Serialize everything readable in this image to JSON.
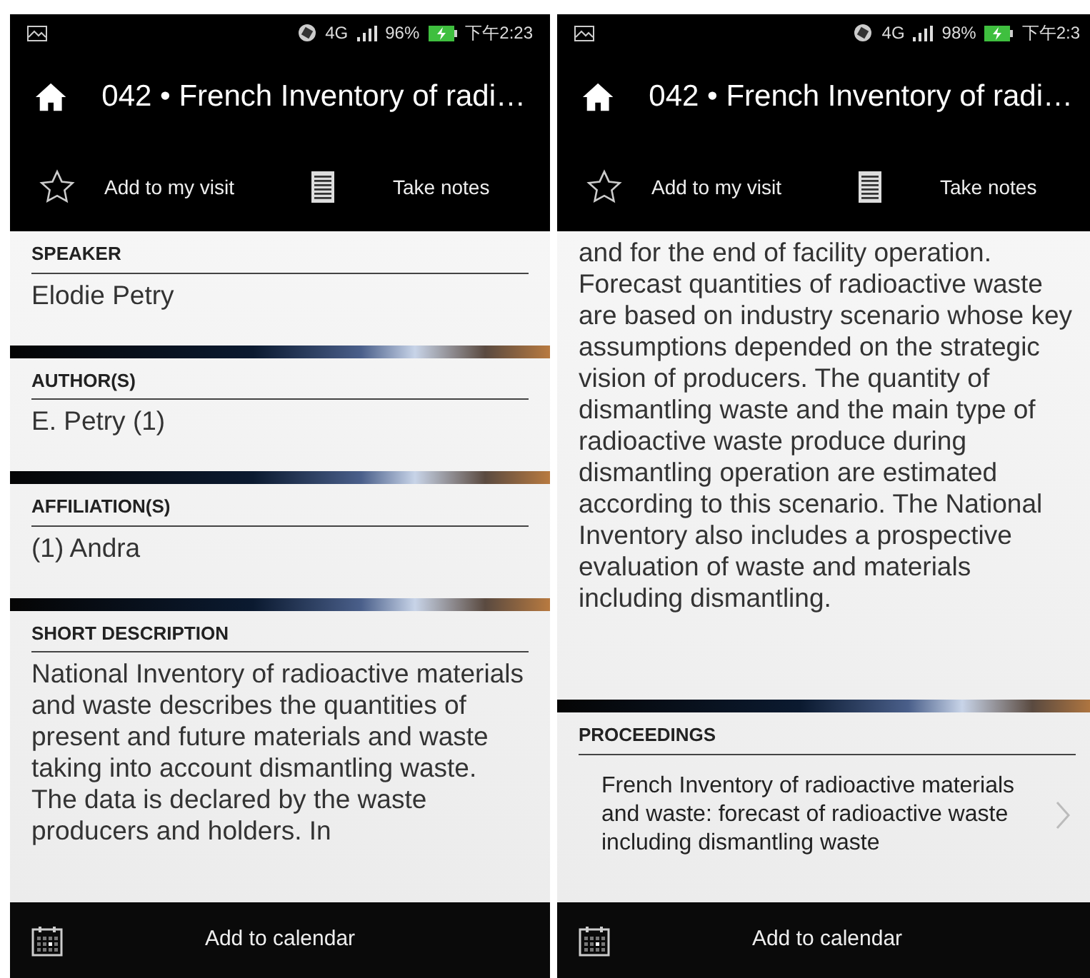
{
  "screens": [
    {
      "status_bar": {
        "network": "4G",
        "battery": "96%",
        "time": "下午2:23"
      },
      "title": "042 • French Inventory of radi…",
      "actions": [
        {
          "kind": "star",
          "label": "Add to my visit"
        },
        {
          "kind": "notes",
          "label": "Take notes"
        }
      ],
      "sections": [
        {
          "kind": "text",
          "heading": "SPEAKER",
          "body": "Elodie Petry"
        },
        {
          "kind": "text",
          "heading": "AUTHOR(S)",
          "body": "E. Petry (1)"
        },
        {
          "kind": "text",
          "heading": "AFFILIATION(S)",
          "body": "(1) Andra"
        },
        {
          "kind": "text",
          "heading": "SHORT DESCRIPTION",
          "body": "National Inventory of radioactive materials and waste describes the quantities of present and future materials and waste taking into account dismantling waste. The data is declared by the waste producers and holders. In"
        }
      ],
      "bottom_bar": {
        "label": "Add to calendar"
      }
    },
    {
      "status_bar": {
        "network": "4G",
        "battery": "98%",
        "time": "下午2:3"
      },
      "title": "042 • French Inventory of radi…",
      "actions": [
        {
          "kind": "star",
          "label": "Add to my visit"
        },
        {
          "kind": "notes",
          "label": "Take notes"
        }
      ],
      "sections": [
        {
          "kind": "text",
          "body": "and for the end of facility operation. Forecast quantities of radioactive waste are based on industry scenario whose key assumptions depended on the strategic vision of producers. The quantity of dismantling waste and the main type of radioactive waste produce during dismantling operation are estimated according to this scenario. The National Inventory also includes a prospective evaluation of waste and materials including dismantling."
        },
        {
          "kind": "link",
          "heading": "PROCEEDINGS",
          "body": "French Inventory of radioactive materials and waste: forecast of radioactive waste including dismantling waste"
        }
      ],
      "bottom_bar": {
        "label": "Add to calendar"
      }
    }
  ]
}
